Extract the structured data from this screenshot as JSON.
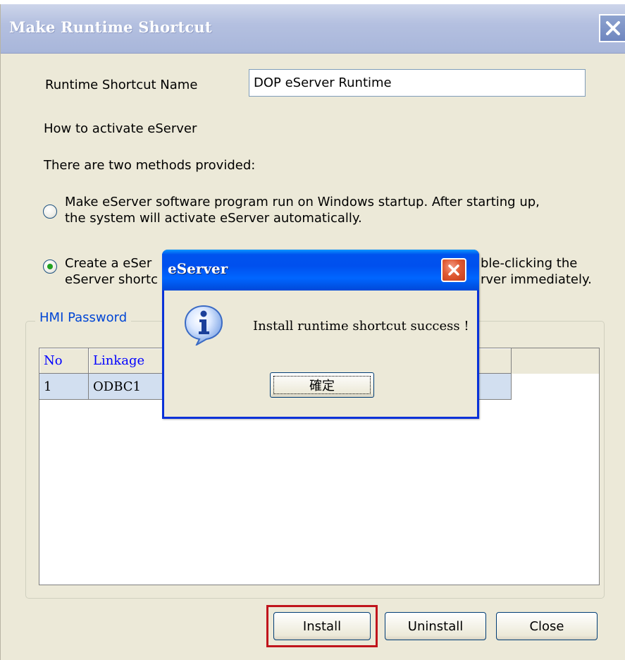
{
  "window": {
    "title": "Make Runtime Shortcut"
  },
  "form": {
    "shortcut_name_label": "Runtime Shortcut Name",
    "shortcut_name_value": "DOP eServer Runtime",
    "activate_heading": "How to activate eServer",
    "methods_heading": "There are two methods provided:",
    "option1_line1": "Make eServer software program run on Windows startup. After starting up,",
    "option1_line2": "the system will activate eServer automatically.",
    "option1_selected": false,
    "option2_line1_left": "Create a eSer",
    "option2_line1_right": "ble-clicking the",
    "option2_line2_left": "eServer shortc",
    "option2_line2_right": "rver immediately.",
    "option2_selected": true
  },
  "password_group": {
    "legend": "HMI Password",
    "columns": [
      "No",
      "Linkage"
    ],
    "rows": [
      {
        "no": "1",
        "linkage": "ODBC1"
      }
    ]
  },
  "buttons": {
    "install": "Install",
    "uninstall": "Uninstall",
    "close": "Close"
  },
  "message_box": {
    "title": "eServer",
    "message": "Install runtime shortcut success !",
    "ok_label": "確定",
    "icon": "info-icon"
  },
  "colors": {
    "dialog_bg": "#ece9d8",
    "xp_blue": "#0053ee",
    "highlight_red": "#c0141c",
    "group_legend": "#0046d5",
    "grid_header_text": "#0000ff",
    "selected_row": "#d2dff0"
  }
}
